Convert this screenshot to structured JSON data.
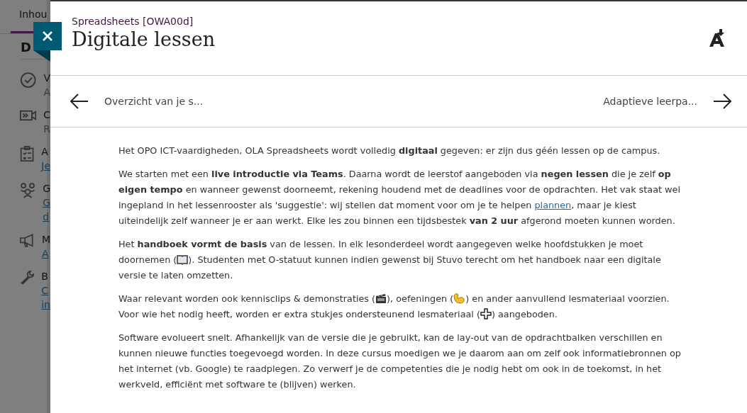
{
  "background_page": {
    "tab": {
      "label": "Inhou",
      "selected": true
    },
    "heading": "D",
    "items": [
      {
        "title": "V",
        "lines": [
          {
            "kind": "text",
            "text": "A"
          }
        ]
      },
      {
        "title": "C",
        "lines": [
          {
            "kind": "text",
            "text": "R"
          }
        ]
      },
      {
        "title": "A",
        "lines": [
          {
            "kind": "link",
            "text": "Je"
          }
        ]
      },
      {
        "title": "G",
        "lines": [
          {
            "kind": "link",
            "text": "G"
          },
          {
            "kind": "link",
            "text": "d"
          }
        ]
      },
      {
        "title": "M",
        "lines": [
          {
            "kind": "link",
            "text": "A"
          }
        ]
      },
      {
        "title": "B",
        "lines": [
          {
            "kind": "link",
            "text": "C"
          },
          {
            "kind": "link",
            "text": "in"
          }
        ]
      }
    ]
  },
  "panel": {
    "course": "Spreadsheets [OWA00d]",
    "title": "Digitale lessen",
    "nav": {
      "previous": "Overzicht van je s...",
      "next": "Adaptieve leerpa..."
    },
    "paragraphs": [
      [
        {
          "kind": "text",
          "text": "Het OPO ICT-vaardigheden, OLA Spreadsheets wordt volledig **digitaal** gegeven: er zijn dus géén lessen op de campus."
        }
      ],
      [
        {
          "kind": "text",
          "text": "We starten met een **live introductie via Teams**. Daarna wordt de leerstof aangeboden via **negen lessen** die je zelf **op eigen tempo** en wanneer gewenst doorneemt, rekening houdend met de deadlines voor de opdrachten. Het vak staat wel ingepland in het lessenrooster als 'suggestie': wij stellen dat moment voor om je te helpen "
        },
        {
          "kind": "link",
          "text": "plannen"
        },
        {
          "kind": "text",
          "text": ", maar je kiest uiteindelijk zelf wanneer je er aan werkt. Elke les zou binnen een tijdsbestek **van 2 uur** afgerond moeten kunnen worden."
        }
      ],
      [
        {
          "kind": "text",
          "text": "Het **handboek vormt de basis** van de lessen. In elk lesonderdeel wordt aangegeven welke hoofdstukken je moet doornemen ("
        },
        {
          "kind": "icon"
        },
        {
          "kind": "text",
          "text": "). Studenten met O-statuut kunnen indien gewenst bij Stuvo terecht om het handboek naar een digitale versie te laten omzetten."
        }
      ],
      [
        {
          "kind": "text",
          "text": "Waar relevant worden ook kennisclips & demonstraties ("
        },
        {
          "kind": "icon"
        },
        {
          "kind": "text",
          "text": "), oefeningen ("
        },
        {
          "kind": "icon"
        },
        {
          "kind": "text",
          "text": ") en ander aanvullend lesmateriaal voorzien. Voor wie het nodig heeft, worden er extra stukjes ondersteunend lesmateriaal ("
        },
        {
          "kind": "icon"
        },
        {
          "kind": "text",
          "text": ") aangeboden."
        }
      ],
      [
        {
          "kind": "text",
          "text": "Software evolueert snelt. Afhankelijk van de versie die je gebruikt, kan de lay-out van de opdrachtbalken verschillen en kunnen nieuwe functies toegevoegd worden. In deze cursus moedigen we je daarom aan om zelf ook informatiebronnen op het internet (vb. Google) te raadplegen. Zo verwerf je de competenties die je nodig hebt om ook in de toekomst, in het werkveld, efficiënt met software te (blijven) werken."
        }
      ]
    ]
  }
}
